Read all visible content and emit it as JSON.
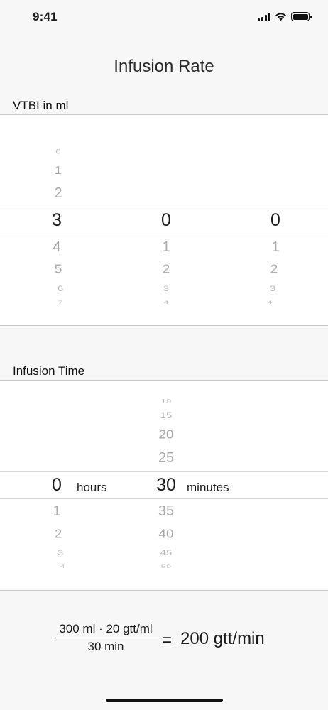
{
  "status_bar": {
    "time": "9:41"
  },
  "title": "Infusion Rate",
  "vtbi": {
    "label": "VTBI in ml",
    "col1": {
      "above": [
        "0",
        "1",
        "2"
      ],
      "selected": "3",
      "below": [
        "4",
        "5",
        "6",
        "7"
      ]
    },
    "col2": {
      "selected": "0",
      "below": [
        "1",
        "2",
        "3",
        "4"
      ]
    },
    "col3": {
      "selected": "0",
      "below": [
        "1",
        "2",
        "3",
        "4"
      ]
    }
  },
  "infusion_time": {
    "label": "Infusion Time",
    "hours": {
      "selected": "0",
      "below": [
        "1",
        "2",
        "3",
        "4"
      ],
      "unit": "hours"
    },
    "minutes": {
      "above": [
        "10",
        "15",
        "20",
        "25"
      ],
      "selected": "30",
      "below": [
        "35",
        "40",
        "45",
        "50"
      ],
      "unit": "minutes"
    }
  },
  "formula": {
    "numerator": "300 ml · 20 gtt/ml",
    "denominator": "30 min",
    "equals": "=",
    "result": "200 gtt/min"
  }
}
